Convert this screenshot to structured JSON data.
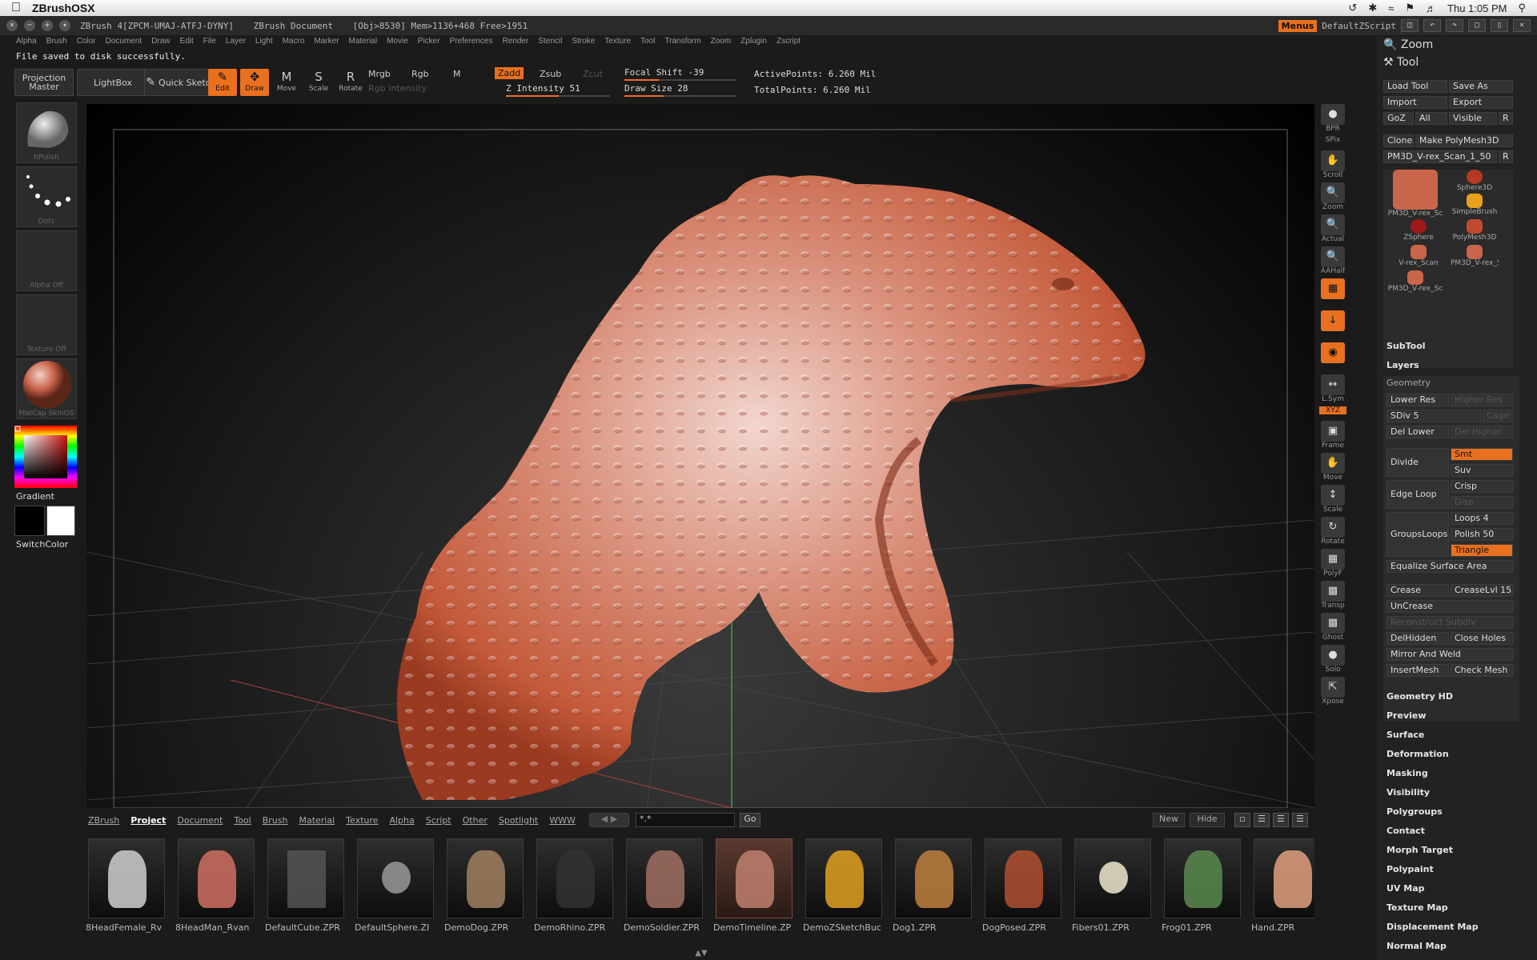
{
  "macbar": {
    "app_name": "ZBrushOSX",
    "clock": "Thu 1:05 PM"
  },
  "title": {
    "version": "ZBrush 4[ZPCM-UMAJ-ATFJ-DYNY]",
    "document": "ZBrush Document",
    "info": "[Obj>8530] Mem>1136+468 Free>1951",
    "menus": "Menus",
    "script": "DefaultZScript"
  },
  "menu_items": [
    "Alpha",
    "Brush",
    "Color",
    "Document",
    "Draw",
    "Edit",
    "File",
    "Layer",
    "Light",
    "Macro",
    "Marker",
    "Material",
    "Movie",
    "Picker",
    "Preferences",
    "Render",
    "Stencil",
    "Stroke",
    "Texture",
    "Tool",
    "Transform",
    "Zoom",
    "Zplugin",
    "Zscript"
  ],
  "status_message": "File saved to disk successfully.",
  "toolbar": {
    "projection_master": "Projection Master",
    "lightbox": "LightBox",
    "quick_sketch": "Quick Sketch",
    "edit": "Edit",
    "draw": "Draw",
    "move": "Move",
    "scale": "Scale",
    "rotate": "Rotate",
    "mrgb": "Mrgb",
    "rgb": "Rgb",
    "m": "M",
    "rgb_intensity": "Rgb Intensity",
    "zadd": "Zadd",
    "zsub": "Zsub",
    "zcut": "Zcut",
    "z_intensity": "Z Intensity 51",
    "focal_shift": "Focal Shift -39",
    "draw_size": "Draw Size 28",
    "active_points": "ActivePoints: 6.260 Mil",
    "total_points": "TotalPoints: 6.260 Mil",
    "z_intensity_value": 51,
    "focal_shift_value": -39,
    "draw_size_value": 28
  },
  "left_shelf": {
    "brush": "hPolish",
    "stroke": "Dots",
    "alpha": "Alpha  Off",
    "texture": "Texture  Off",
    "material": "MatCap SkinOS",
    "gradient": "Gradient",
    "switch_color": "SwitchColor"
  },
  "right_column": [
    "BPR",
    "SPix",
    "Scroll",
    "Zoom",
    "Actual",
    "AAHalf",
    "Persp",
    "Floor",
    "Local",
    "L.Sym",
    "XYZ",
    "Frame",
    "Move",
    "Scale",
    "Rotate",
    "PolyF",
    "Transp",
    "Ghost",
    "Solo",
    "Xpose"
  ],
  "palette": {
    "zoom": "Zoom",
    "tool": "Tool",
    "load_tool": "Load Tool",
    "save_as": "Save As",
    "import": "Import",
    "export": "Export",
    "goz": "GoZ",
    "all": "All",
    "visible": "Visible",
    "r": "R",
    "clone": "Clone",
    "make_polymesh": "Make PolyMesh3D",
    "current_tool": "PM3D_V-rex_Scan_1_50",
    "thumbs": [
      "PM3D_V-rex_Sc",
      "Sphere3D",
      "SimpleBrush",
      "ZSphere",
      "PolyMesh3D",
      "V-rex_Scan",
      "PM3D_V-rex_Sc",
      "PM3D_V-rex_Sc"
    ],
    "subtool": "SubTool",
    "layers": "Layers",
    "geometry": "Geometry",
    "lower_res": "Lower Res",
    "higher_res": "Higher Res",
    "sdiv": "SDiv 5",
    "cage": "Cage",
    "del_lower": "Del Lower",
    "del_higher": "Del Higher",
    "divide": "Divide",
    "smt": "Smt",
    "suv": "Suv",
    "edge_loop": "Edge Loop",
    "crisp": "Crisp",
    "disp": "Disp",
    "groups_loops": "GroupsLoops",
    "loops": "Loops 4",
    "polish": "Polish 50",
    "triangle": "Triangle",
    "equalize": "Equalize Surface Area",
    "crease": "Crease",
    "crease_lvl": "CreaseLvl 15",
    "uncrease": "UnCrease",
    "reconstruct": "Reconstruct Subdiv",
    "delhidden": "DelHidden",
    "close_holes": "Close Holes",
    "mirror_weld": "Mirror And Weld",
    "insertmesh": "InsertMesh",
    "check_mesh": "Check Mesh",
    "sections": [
      "Geometry HD",
      "Preview",
      "Surface",
      "Deformation",
      "Masking",
      "Visibility",
      "Polygroups",
      "Contact",
      "Morph Target",
      "Polypaint",
      "UV Map",
      "Texture Map",
      "Displacement Map",
      "Normal Map"
    ]
  },
  "lightbox": {
    "tabs": [
      "ZBrush",
      "Project",
      "Document",
      "Tool",
      "Brush",
      "Material",
      "Texture",
      "Alpha",
      "Script",
      "Other",
      "Spotlight",
      "WWW"
    ],
    "active_tab": "Project",
    "filter": "*.*",
    "go": "Go",
    "new": "New",
    "hide": "Hide",
    "files": [
      "8HeadFemale_Rv",
      "8HeadMan_Rvan",
      "DefaultCube.ZPR",
      "DefaultSphere.ZI",
      "DemoDog.ZPR",
      "DemoRhino.ZPR",
      "DemoSoldier.ZPR",
      "DemoTimeline.ZP",
      "DemoZSketchBuc",
      "Dog1.ZPR",
      "DogPosed.ZPR",
      "Fibers01.ZPR",
      "Frog01.ZPR",
      "Hand.ZPR"
    ],
    "selected_index": 7
  },
  "colors": {
    "accent": "#e8701f",
    "sculpt": "#c9654a",
    "bg": "#1b1b1b"
  }
}
